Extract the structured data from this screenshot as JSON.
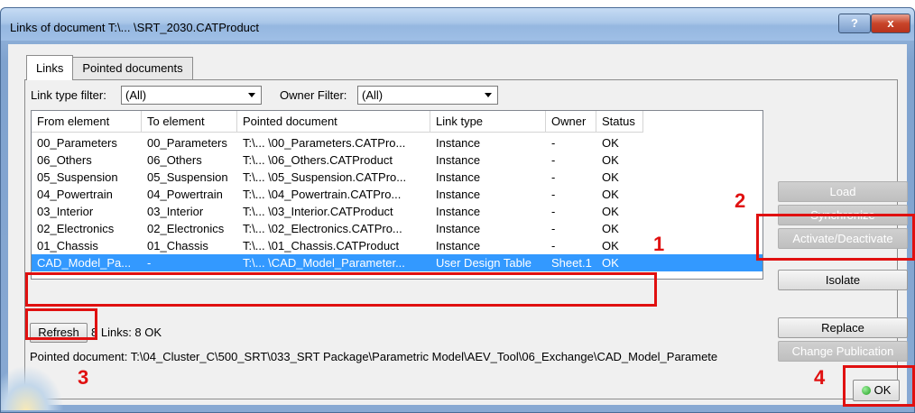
{
  "window": {
    "title": "Links of document T:\\... \\SRT_2030.CATProduct",
    "help_label": "?",
    "close_label": "x"
  },
  "tabs": [
    {
      "label": "Links",
      "active": true
    },
    {
      "label": "Pointed documents",
      "active": false
    }
  ],
  "filters": {
    "link_type_label": "Link type filter:",
    "link_type_value": "(All)",
    "owner_label": "Owner Filter:",
    "owner_value": "(All)"
  },
  "table": {
    "columns": [
      "From element",
      "To element",
      "Pointed document",
      "Link type",
      "Owner",
      "Status"
    ],
    "rows": [
      {
        "from": "00_Parameters",
        "to": "00_Parameters",
        "doc": "T:\\... \\00_Parameters.CATPro...",
        "type": "Instance",
        "owner": "-",
        "status": "OK"
      },
      {
        "from": "06_Others",
        "to": "06_Others",
        "doc": "T:\\... \\06_Others.CATProduct",
        "type": "Instance",
        "owner": "-",
        "status": "OK"
      },
      {
        "from": "05_Suspension",
        "to": "05_Suspension",
        "doc": "T:\\... \\05_Suspension.CATPro...",
        "type": "Instance",
        "owner": "-",
        "status": "OK"
      },
      {
        "from": "04_Powertrain",
        "to": "04_Powertrain",
        "doc": "T:\\... \\04_Powertrain.CATPro...",
        "type": "Instance",
        "owner": "-",
        "status": "OK"
      },
      {
        "from": "03_Interior",
        "to": "03_Interior",
        "doc": "T:\\... \\03_Interior.CATProduct",
        "type": "Instance",
        "owner": "-",
        "status": "OK"
      },
      {
        "from": "02_Electronics",
        "to": "02_Electronics",
        "doc": "T:\\... \\02_Electronics.CATPro...",
        "type": "Instance",
        "owner": "-",
        "status": "OK"
      },
      {
        "from": "01_Chassis",
        "to": "01_Chassis",
        "doc": "T:\\... \\01_Chassis.CATProduct",
        "type": "Instance",
        "owner": "-",
        "status": "OK"
      },
      {
        "from": "CAD_Model_Pa...",
        "to": "-",
        "doc": "T:\\... \\CAD_Model_Parameter...",
        "type": "User Design Table",
        "owner": "Sheet.1",
        "status": "OK",
        "selected": true
      }
    ]
  },
  "side_buttons": {
    "load": "Load",
    "synchronize": "Synchronize",
    "activate": "Activate/Deactivate",
    "isolate": "Isolate",
    "replace": "Replace",
    "change_publication": "Change Publication"
  },
  "footer": {
    "refresh": "Refresh",
    "links_summary": "8 Links: 8 OK",
    "pointed_document": "Pointed document: T:\\04_Cluster_C\\500_SRT\\033_SRT Package\\Parametric Model\\AEV_Tool\\06_Exchange\\CAD_Model_Paramete",
    "ok": "OK"
  },
  "annotations": [
    "1",
    "2",
    "3",
    "4"
  ],
  "colors": {
    "selection": "#3399ff",
    "annotation": "#e01010"
  }
}
